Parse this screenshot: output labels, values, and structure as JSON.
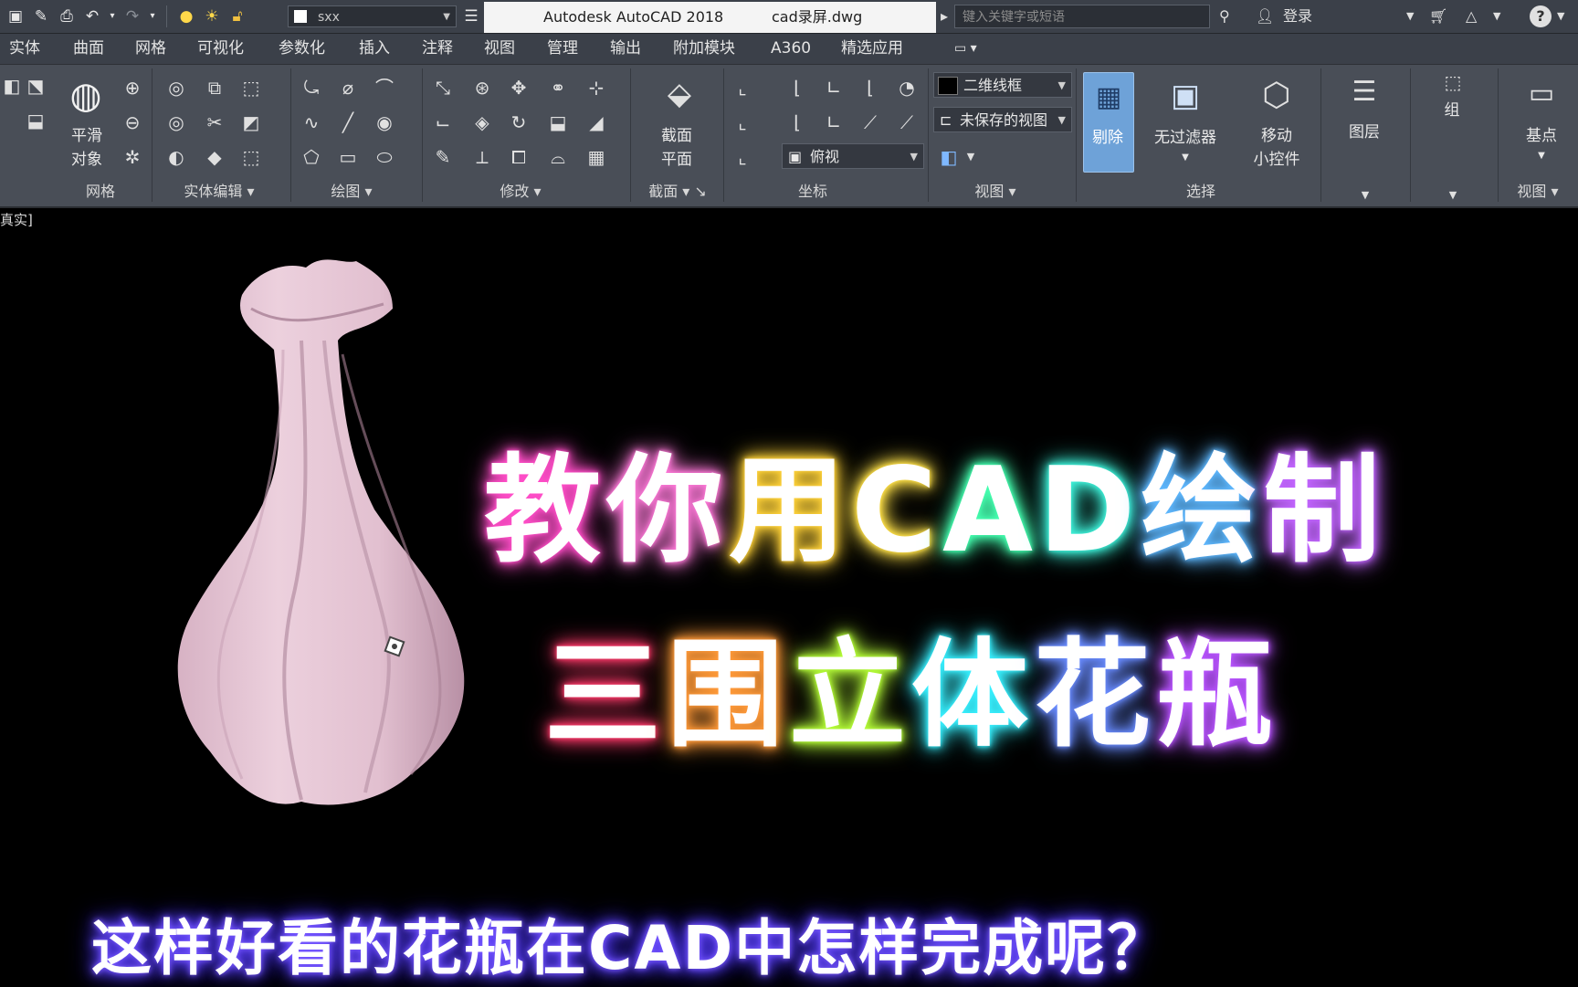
{
  "titlebar": {
    "workspace": "sxx",
    "app_title": "Autodesk AutoCAD 2018",
    "file_name": "cad录屏.dwg",
    "search_placeholder": "键入关键字或短语",
    "login": "登录"
  },
  "menu": [
    "实体",
    "曲面",
    "网格",
    "可视化",
    "参数化",
    "插入",
    "注释",
    "视图",
    "管理",
    "输出",
    "附加模块",
    "A360",
    "精选应用"
  ],
  "ribbon": {
    "smooth_label_1": "平滑",
    "smooth_label_2": "对象",
    "section_label_1": "截面",
    "section_label_2": "平面",
    "visual_style": "二维线框",
    "saved_view": "未保存的视图",
    "view_combo": "俯视",
    "cull_label": "剔除",
    "filter_label": "无过滤器",
    "move_label_1": "移动",
    "move_label_2": "小控件",
    "layer_label": "图层",
    "group_label": "组",
    "basepoint_label": "基点",
    "panels": [
      "网格",
      "实体编辑",
      "绘图",
      "修改",
      "截面",
      "坐标",
      "视图",
      "选择",
      "视图"
    ]
  },
  "viewport_label": "真实]",
  "overlay": {
    "title_line1": [
      "教",
      "你",
      "用",
      "C",
      "A",
      "D",
      "绘",
      "制"
    ],
    "title_line2": [
      "三",
      "围",
      "立",
      "体",
      "花",
      "瓶"
    ],
    "title_colors1": [
      "#ff4fc8",
      "#ff7ad9",
      "#ffd23a",
      "#ffe14a",
      "#46ffb0",
      "#3ff0d8",
      "#5fb8ff",
      "#c266ff"
    ],
    "title_colors2": [
      "#ff3b6b",
      "#ff9a3a",
      "#b7ff3a",
      "#39f0ff",
      "#6a8cff",
      "#b955ff"
    ],
    "subtitle": "这样好看的花瓶在CAD中怎样完成呢？"
  },
  "colors": {
    "vase": "#e4c2d2",
    "vase_shadow": "#b58fa3",
    "ribbon_bg": "#494e57",
    "titlebar_bg": "#3b4049"
  }
}
